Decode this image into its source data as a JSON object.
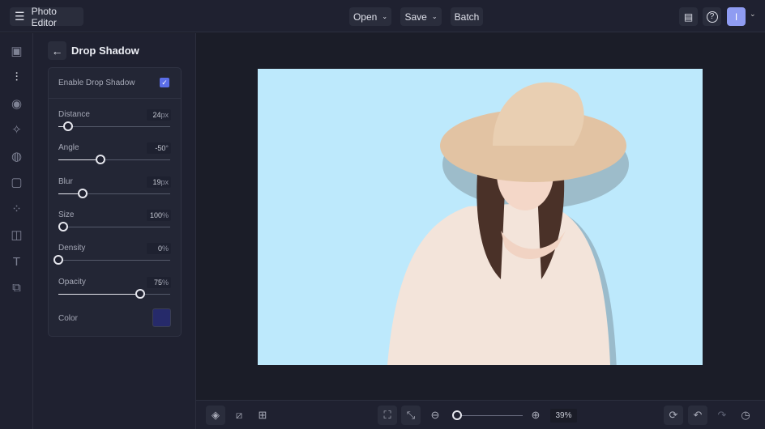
{
  "header": {
    "app_title": "Photo Editor",
    "open_label": "Open",
    "save_label": "Save",
    "batch_label": "Batch",
    "avatar_initial": "I"
  },
  "panel": {
    "title": "Drop Shadow",
    "enable_label": "Enable Drop Shadow",
    "enabled": true,
    "sliders": [
      {
        "label": "Distance",
        "value": "24",
        "unit": "px",
        "level": 0.09
      },
      {
        "label": "Angle",
        "value": "-50",
        "unit": "°",
        "level": 0.38
      },
      {
        "label": "Blur",
        "value": "19",
        "unit": "px",
        "level": 0.22
      },
      {
        "label": "Size",
        "value": "100",
        "unit": "%",
        "level": 0.04
      },
      {
        "label": "Density",
        "value": "0",
        "unit": "%",
        "level": 0
      },
      {
        "label": "Opacity",
        "value": "75",
        "unit": "%",
        "level": 0.73
      }
    ],
    "color_label": "Color",
    "color_value": "#262a6a"
  },
  "bottom": {
    "zoom": "39%",
    "zoom_level": 0.05
  },
  "colors": {
    "accent": "#5b6ee8",
    "canvas_bg": "#bde9fc"
  }
}
